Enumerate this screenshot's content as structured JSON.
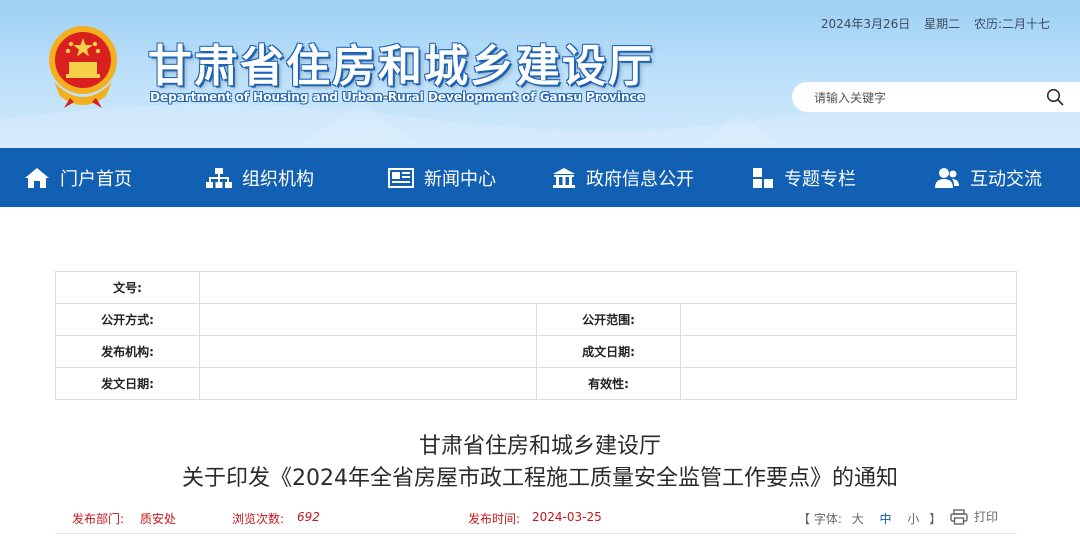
{
  "header": {
    "title_cn": "甘肃省住房和城乡建设厅",
    "title_en": "Department of Housing and Urban-Rural Development of Gansu Province",
    "date": "2024年3月26日",
    "weekday": "星期二",
    "lunar": "农历:二月十七",
    "search_placeholder": "请输入关键字"
  },
  "nav": {
    "items": [
      {
        "label": "门户首页",
        "icon": "home-icon"
      },
      {
        "label": "组织机构",
        "icon": "org-chart-icon"
      },
      {
        "label": "新闻中心",
        "icon": "newspaper-icon"
      },
      {
        "label": "政府信息公开",
        "icon": "government-building-icon"
      },
      {
        "label": "专题专栏",
        "icon": "grid-tiles-icon"
      },
      {
        "label": "互动交流",
        "icon": "users-icon"
      }
    ]
  },
  "meta": {
    "doc_no_label": "文号:",
    "open_method_label": "公开方式:",
    "open_scope_label": "公开范围:",
    "publisher_label": "发布机构:",
    "created_date_label": "成文日期:",
    "issue_date_label": "发文日期:",
    "validity_label": "有效性:"
  },
  "article": {
    "title_line1": "甘肃省住房和城乡建设厅",
    "title_line2": "关于印发《2024年全省房屋市政工程施工质量安全监管工作要点》的通知"
  },
  "info": {
    "dept_label": "发布部门:",
    "dept_value": "质安处",
    "views_label": "浏览次数:",
    "views_value": "692",
    "time_label": "发布时间:",
    "time_value": "2024-03-25",
    "font_label": "【 字体:",
    "font_large": "大",
    "font_medium": "中",
    "font_small": "小",
    "font_close": "】",
    "print_label": "打印"
  },
  "colors": {
    "nav_bg": "#1160b3",
    "accent_red": "#c8161d",
    "header_sky": "#9dd0f4"
  }
}
